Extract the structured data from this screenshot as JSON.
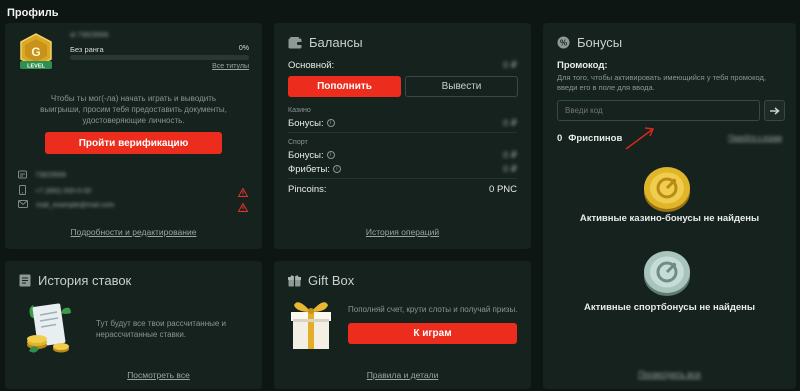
{
  "page": {
    "title": "Профиль"
  },
  "profile": {
    "username": "id 73829566",
    "rank_label": "Без ранга",
    "progress_percent_label": "0%",
    "progress_fraction": 0,
    "all_titles_link": "Все титулы",
    "level_badge_text": "LEVEL",
    "verify_text": "Чтобы ты мог(-ла) начать играть и выводить выигрыши, просим тебя предоставить документы, удостоверяющие личность.",
    "verify_button": "Пройти верификацию",
    "id_value": "73829566",
    "phone_value": "+7 (900) 000-0-00",
    "email_value": "mail_example@mail.com",
    "details_link": "Подробности и редактирование"
  },
  "balances": {
    "title": "Балансы",
    "main_label": "Основной:",
    "main_value": "0 ₽",
    "deposit_button": "Пополнить",
    "withdraw_button": "Вывести",
    "casino_section": "Казино",
    "casino_bonuses_label": "Бонусы:",
    "casino_bonuses_value": "0 ₽",
    "sport_section": "Спорт",
    "sport_bonuses_label": "Бонусы:",
    "sport_bonuses_value": "0 ₽",
    "freebets_label": "Фрибеты:",
    "freebets_value": "0 ₽",
    "pincoins_label": "Pincoins:",
    "pincoins_value": "0 PNC",
    "history_link": "История операций"
  },
  "bonuses": {
    "title": "Бонусы",
    "promo_label": "Промокод:",
    "promo_hint": "Для того, чтобы активировать имеющийся у тебя промокод, введи его в поле для ввода.",
    "promo_placeholder": "Введи код",
    "freespins_count": "0",
    "freespins_label": "Фриспинов",
    "freespins_link": "Перейти к играм",
    "casino_empty": "Активные казино-бонусы не найдены",
    "sport_empty": "Активные спортбонусы не найдены",
    "bottom_link": "Посмотреть все"
  },
  "bet_history": {
    "title": "История ставок",
    "text": "Тут будут все твои рассчитанные и нерассчитанные ставки.",
    "link": "Посмотреть все"
  },
  "gift_box": {
    "title": "Gift Box",
    "text": "Пополняй счет, крути слоты и получай призы.",
    "button": "К играм",
    "link": "Правила и детали"
  },
  "colors": {
    "accent_red": "#ec2c1c",
    "card_bg": "#16221e",
    "page_bg": "#0d1613",
    "coin_gold": "#e0b52a",
    "coin_silver": "#a9c4bd",
    "warning_red": "#e0342a"
  }
}
